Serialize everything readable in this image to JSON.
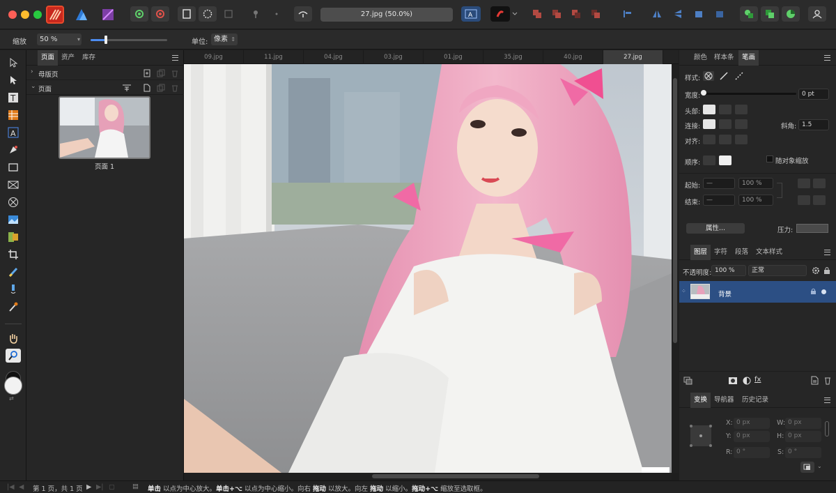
{
  "window": {
    "title": "27.jpg (50.0%)"
  },
  "context_bar": {
    "zoom_label": "缩放",
    "zoom_value": "50 %",
    "unit_label": "单位:",
    "unit_value": "像素"
  },
  "pages_panel": {
    "tabs": [
      "页面",
      "资产",
      "库存"
    ],
    "master_label": "母版页",
    "pages_label": "页面",
    "page1_label": "页面 1"
  },
  "doc_tabs": [
    "09.jpg",
    "11.jpg",
    "04.jpg",
    "03.jpg",
    "01.jpg",
    "35.jpg",
    "40.jpg",
    "27.jpg"
  ],
  "stroke_panel": {
    "tabs": [
      "颜色",
      "样本条",
      "笔画"
    ],
    "style_label": "样式:",
    "width_label": "宽度:",
    "width_value": "0 pt",
    "cap_label": "头部:",
    "join_label": "连接:",
    "miter_label": "斜角:",
    "miter_value": "1.5",
    "align_label": "对齐:",
    "order_label": "顺序:",
    "scale_label": "随对象缩放",
    "start_label": "起始:",
    "start_pct": "100 %",
    "end_label": "结束:",
    "end_pct": "100 %",
    "props_label": "属性...",
    "pressure_label": "压力:"
  },
  "layers_panel": {
    "tabs": [
      "图层",
      "字符",
      "段落",
      "文本样式"
    ],
    "opacity_label": "不透明度:",
    "opacity_value": "100 %",
    "blend_value": "正常",
    "layer_name": "背景"
  },
  "transform_panel": {
    "tabs": [
      "变换",
      "导航器",
      "历史记录"
    ],
    "x_label": "X:",
    "x_value": "0 px",
    "y_label": "Y:",
    "y_value": "0 px",
    "w_label": "W:",
    "w_value": "0 px",
    "h_label": "H:",
    "h_value": "0 px",
    "r_label": "R:",
    "r_value": "0 °",
    "s_label": "S:",
    "s_value": "0 °"
  },
  "status_bar": {
    "page_info": "第 1 页，共 1 页",
    "hint_1b": "单击",
    "hint_1": " 以点为中心放大。",
    "hint_2b": "单击+⌥",
    "hint_2": " 以点为中心缩小。向右 ",
    "hint_3b": "拖动",
    "hint_3": " 以放大。向左 ",
    "hint_4b": "拖动",
    "hint_4": " 以缩小。",
    "hint_5b": "拖动+⌥",
    "hint_5": " 缩放至选取框。"
  }
}
